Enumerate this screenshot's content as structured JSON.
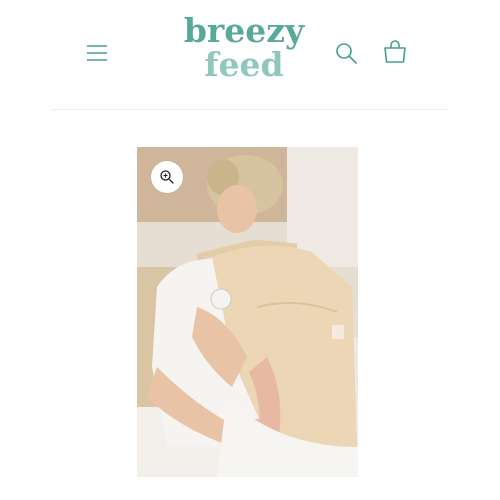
{
  "header": {
    "logo": {
      "line1": "breezy",
      "line2": "feed"
    },
    "icons": {
      "menu": "hamburger-menu-icon",
      "search": "search-icon",
      "cart": "cart-icon"
    }
  },
  "product": {
    "image": {
      "zoom_icon": "zoom-in-icon"
    }
  },
  "colors": {
    "brand_dark": "#5aa89a",
    "brand_light": "#8fc7bd",
    "icon": "#44a08c",
    "cover_fabric": "#ecd6b6"
  }
}
